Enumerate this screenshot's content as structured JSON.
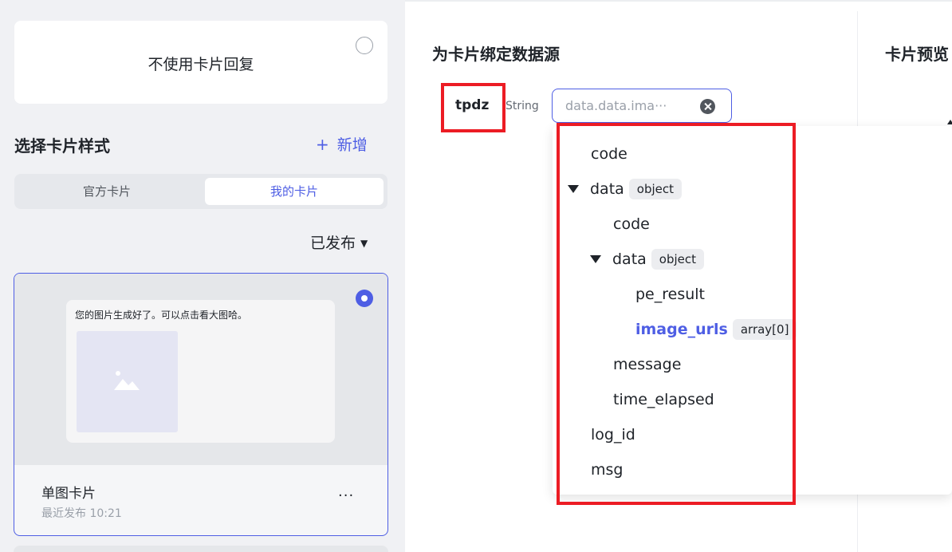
{
  "left": {
    "no_card_label": "不使用卡片回复",
    "section_title": "选择卡片样式",
    "add_label": "新增",
    "add_plus": "+",
    "tabs": [
      {
        "label": "官方卡片",
        "active": false
      },
      {
        "label": "我的卡片",
        "active": true
      }
    ],
    "filter_label": "已发布",
    "filter_caret": "▼",
    "card": {
      "preview_text": "您的图片生成好了。可以点击看大图哈。",
      "name": "单图卡片",
      "meta": "最近发布 10:21",
      "more": "···",
      "selected": true
    }
  },
  "binding": {
    "title": "为卡片绑定数据源",
    "param_name": "tpdz",
    "param_type": "String",
    "source_value": "data.data.ima···"
  },
  "preview": {
    "title": "卡片预览"
  },
  "tree": [
    {
      "key": "code",
      "tag": ""
    },
    {
      "key": "data",
      "tag": "object"
    },
    {
      "key": "code",
      "tag": ""
    },
    {
      "key": "data",
      "tag": "object"
    },
    {
      "key": "pe_result",
      "tag": ""
    },
    {
      "key": "image_urls",
      "tag": "array[0]"
    },
    {
      "key": "message",
      "tag": ""
    },
    {
      "key": "time_elapsed",
      "tag": ""
    },
    {
      "key": "log_id",
      "tag": ""
    },
    {
      "key": "msg",
      "tag": ""
    }
  ],
  "colors": {
    "accent": "#4e5ee4",
    "highlight_box": "#ec1c24"
  }
}
